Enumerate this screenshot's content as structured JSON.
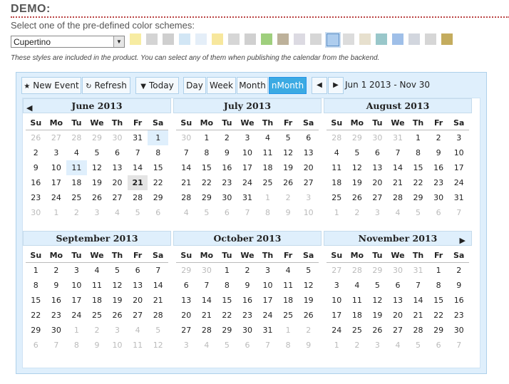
{
  "header": {
    "title": "DEMO:",
    "subtitle": "Select one of the pre-defined color schemes:",
    "scheme_selected": "Cupertino",
    "note": "These styles are included in the product. You can select any of them when publishing the calendar from the backend."
  },
  "swatches": [
    {
      "color": "#f7eca2"
    },
    {
      "color": "#d4d4d4"
    },
    {
      "color": "#cfcfcf"
    },
    {
      "color": "#d2e6f5"
    },
    {
      "color": "#e4eef8"
    },
    {
      "color": "#f7e79d"
    },
    {
      "color": "#d6d6d6"
    },
    {
      "color": "#d0d0d0"
    },
    {
      "color": "#9fcf7d"
    },
    {
      "color": "#bdb19a"
    },
    {
      "color": "#dcdae2"
    },
    {
      "color": "#d6d6d6"
    },
    {
      "color": "#aecdee",
      "selected": true
    },
    {
      "color": "#dcdcdc"
    },
    {
      "color": "#e7e0ce"
    },
    {
      "color": "#99c7ca"
    },
    {
      "color": "#9fbfe8"
    },
    {
      "color": "#d2d6de"
    },
    {
      "color": "#d6d6d6"
    },
    {
      "color": "#c4ac5e"
    }
  ],
  "toolbar": {
    "new_event": "New Event",
    "refresh": "Refresh",
    "today": "Today",
    "views": [
      "Day",
      "Week",
      "Month",
      "nMonth"
    ],
    "active_view": "nMonth",
    "range": "Jun 1 2013 - Nov 30"
  },
  "weekdays": [
    "Su",
    "Mo",
    "Tu",
    "We",
    "Th",
    "Fr",
    "Sa"
  ],
  "months": [
    {
      "name": "June 2013",
      "cur_start": 5,
      "cur_end": 34,
      "days": [
        26,
        27,
        28,
        29,
        30,
        31,
        1,
        2,
        3,
        4,
        5,
        6,
        7,
        8,
        9,
        10,
        11,
        12,
        13,
        14,
        15,
        16,
        17,
        18,
        19,
        20,
        21,
        22,
        23,
        24,
        25,
        26,
        27,
        28,
        29,
        30,
        1,
        2,
        3,
        4,
        5,
        6
      ],
      "selected": [
        6,
        16
      ],
      "today": [
        26
      ]
    },
    {
      "name": "July 2013",
      "cur_start": 1,
      "cur_end": 31,
      "days": [
        30,
        1,
        2,
        3,
        4,
        5,
        6,
        7,
        8,
        9,
        10,
        11,
        12,
        13,
        14,
        15,
        16,
        17,
        18,
        19,
        20,
        21,
        22,
        23,
        24,
        25,
        26,
        27,
        28,
        29,
        30,
        31,
        1,
        2,
        3,
        4,
        5,
        6,
        7,
        8,
        9,
        10
      ],
      "selected": [],
      "today": []
    },
    {
      "name": "August 2013",
      "cur_start": 4,
      "cur_end": 34,
      "days": [
        28,
        29,
        30,
        31,
        1,
        2,
        3,
        4,
        5,
        6,
        7,
        8,
        9,
        10,
        11,
        12,
        13,
        14,
        15,
        16,
        17,
        18,
        19,
        20,
        21,
        22,
        23,
        24,
        25,
        26,
        27,
        28,
        29,
        30,
        31,
        1,
        2,
        3,
        4,
        5,
        6,
        7
      ],
      "selected": [],
      "today": []
    },
    {
      "name": "September 2013",
      "cur_start": 0,
      "cur_end": 29,
      "days": [
        1,
        2,
        3,
        4,
        5,
        6,
        7,
        8,
        9,
        10,
        11,
        12,
        13,
        14,
        15,
        16,
        17,
        18,
        19,
        20,
        21,
        22,
        23,
        24,
        25,
        26,
        27,
        28,
        29,
        30,
        1,
        2,
        3,
        4,
        5,
        6,
        7,
        8,
        9,
        10,
        11,
        12
      ],
      "selected": [],
      "today": []
    },
    {
      "name": "October 2013",
      "cur_start": 2,
      "cur_end": 32,
      "days": [
        29,
        30,
        1,
        2,
        3,
        4,
        5,
        6,
        7,
        8,
        9,
        10,
        11,
        12,
        13,
        14,
        15,
        16,
        17,
        18,
        19,
        20,
        21,
        22,
        23,
        24,
        25,
        26,
        27,
        28,
        29,
        30,
        31,
        1,
        2,
        3,
        4,
        5,
        6,
        7,
        8,
        9
      ],
      "selected": [],
      "today": []
    },
    {
      "name": "November 2013",
      "cur_start": 5,
      "cur_end": 34,
      "days": [
        27,
        28,
        29,
        30,
        31,
        1,
        2,
        3,
        4,
        5,
        6,
        7,
        8,
        9,
        10,
        11,
        12,
        13,
        14,
        15,
        16,
        17,
        18,
        19,
        20,
        21,
        22,
        23,
        24,
        25,
        26,
        27,
        28,
        29,
        30,
        1,
        2,
        3,
        4,
        5,
        6,
        7
      ],
      "selected": [],
      "today": []
    }
  ]
}
